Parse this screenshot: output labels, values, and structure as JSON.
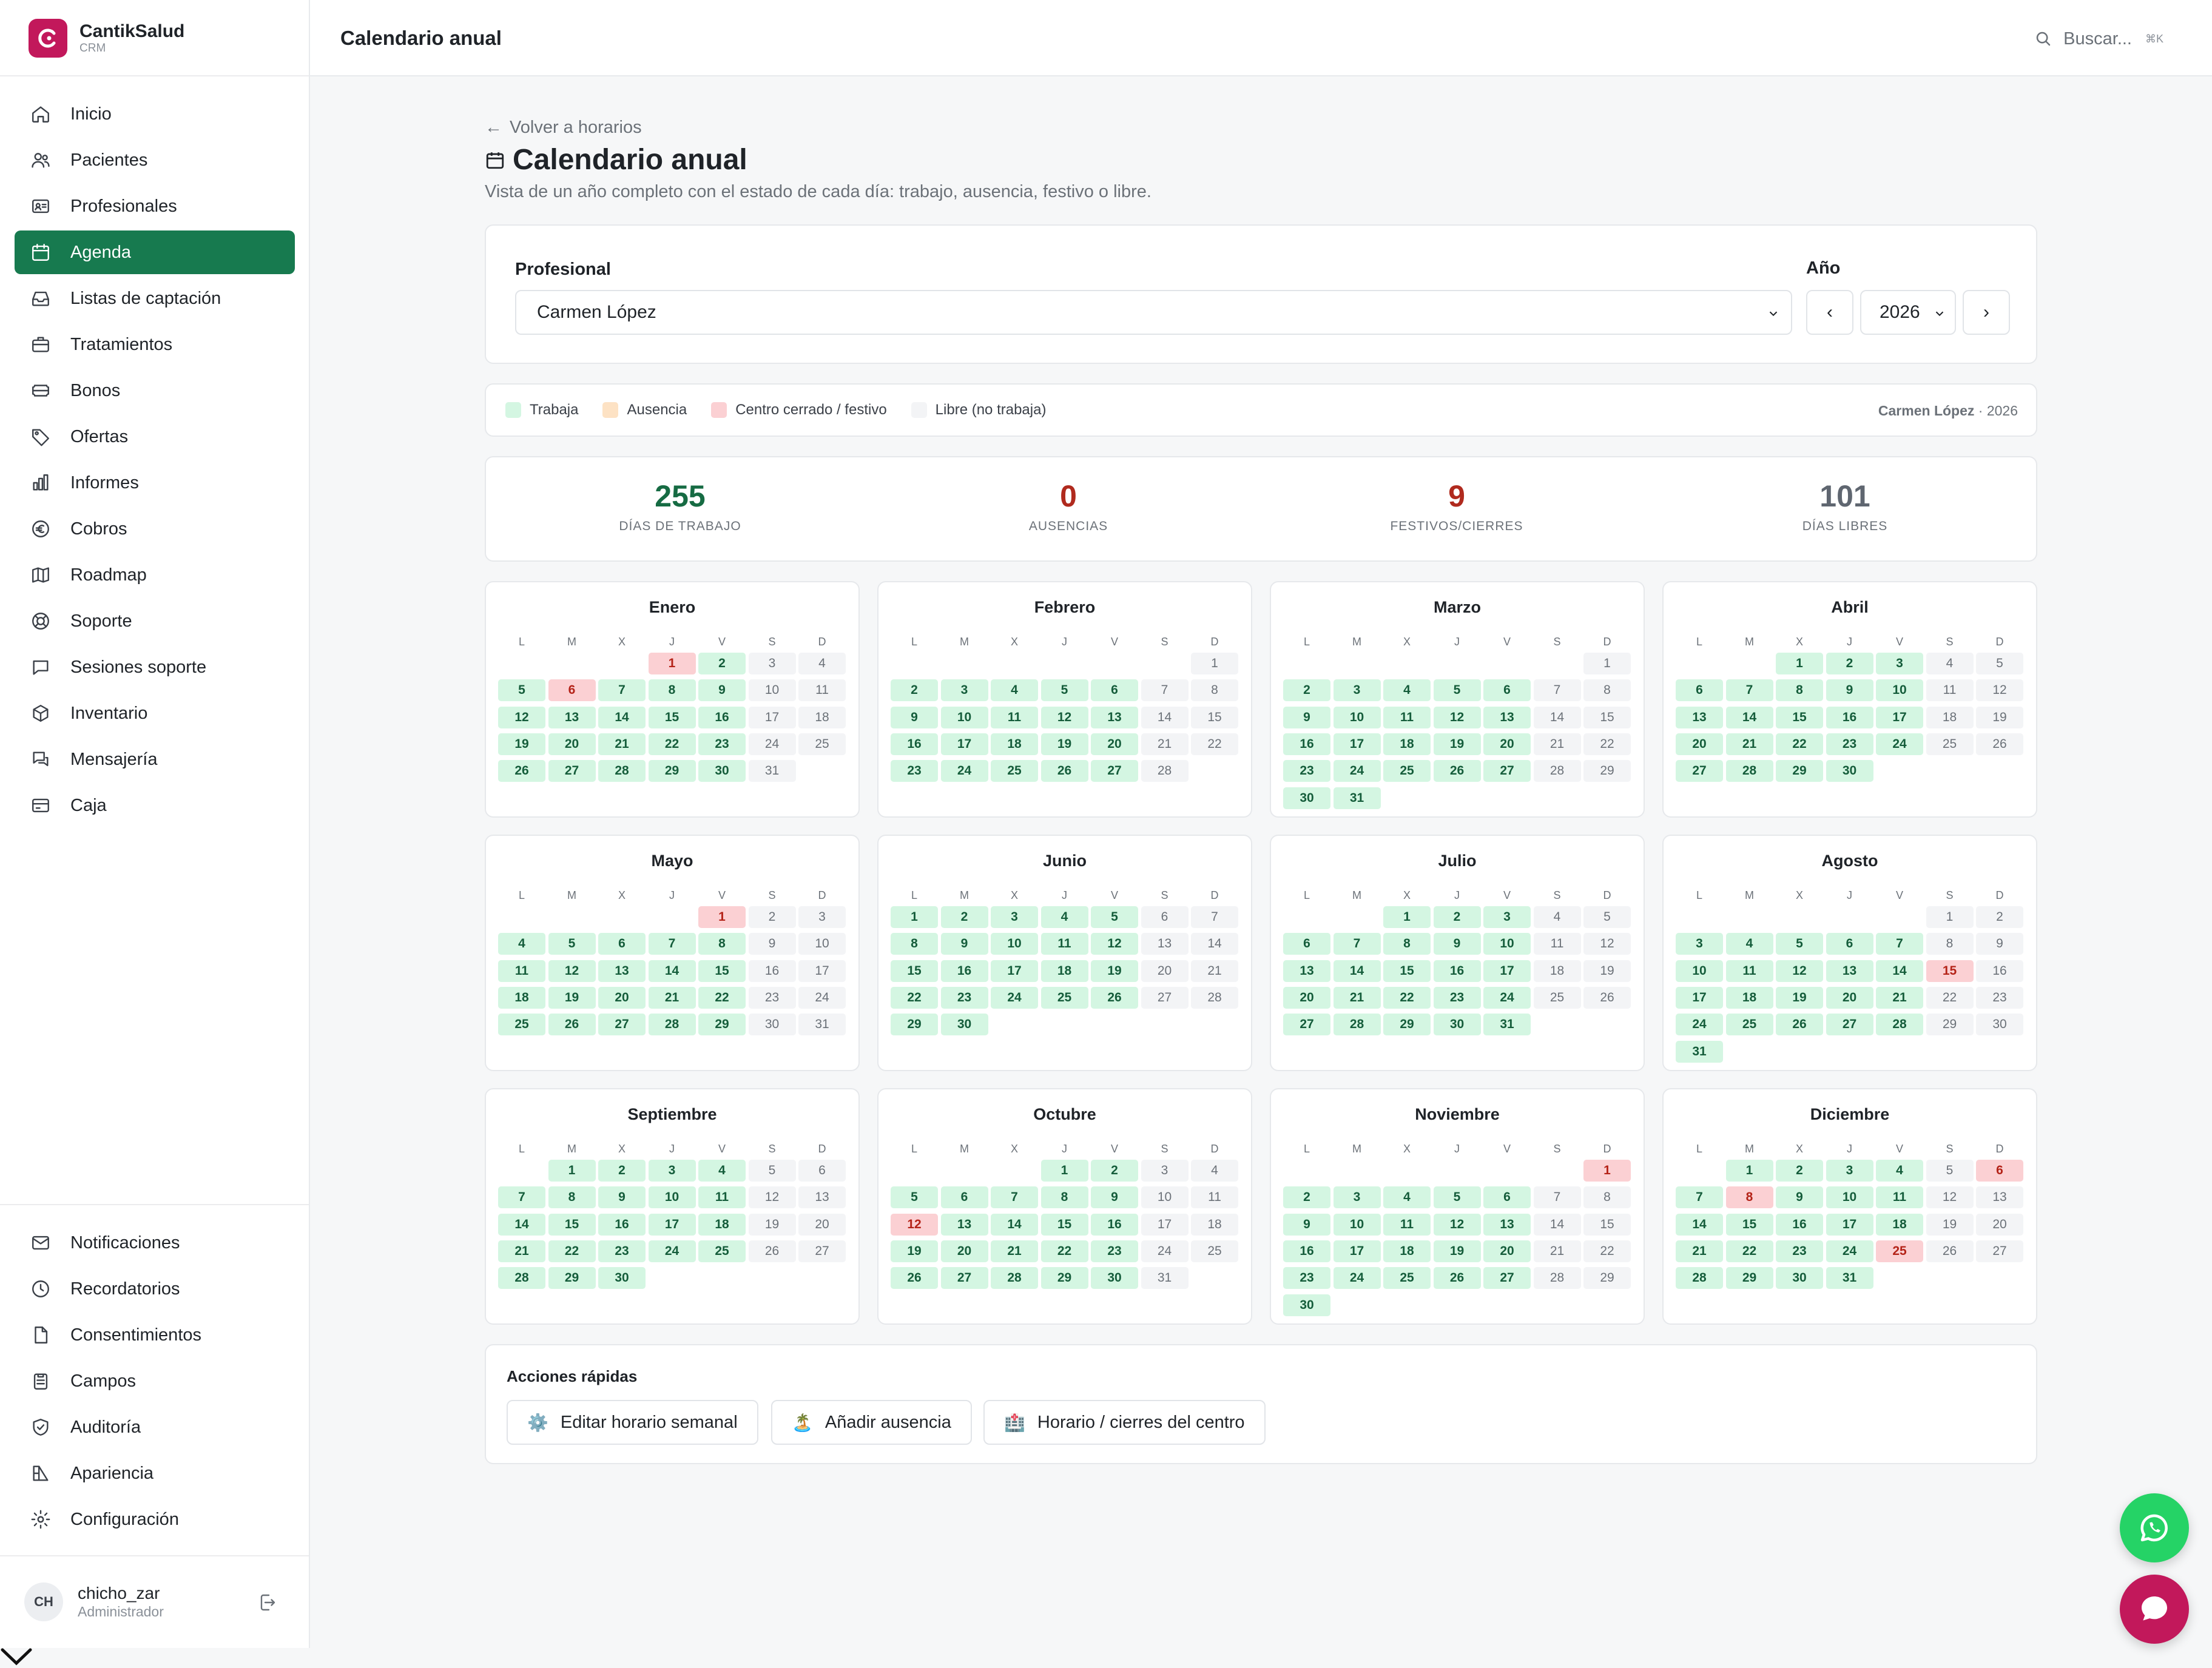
{
  "brand": {
    "name": "CantikSalud",
    "sub": "CRM"
  },
  "nav": [
    {
      "label": "Inicio",
      "icon": "home-icon"
    },
    {
      "label": "Pacientes",
      "icon": "users-icon"
    },
    {
      "label": "Profesionales",
      "icon": "id-card-icon"
    },
    {
      "label": "Agenda",
      "icon": "calendar-icon",
      "active": true
    },
    {
      "label": "Listas de captación",
      "icon": "inbox-icon"
    },
    {
      "label": "Tratamientos",
      "icon": "briefcase-icon"
    },
    {
      "label": "Bonos",
      "icon": "ticket-icon"
    },
    {
      "label": "Ofertas",
      "icon": "tag-icon"
    },
    {
      "label": "Informes",
      "icon": "bar-chart-icon"
    },
    {
      "label": "Cobros",
      "icon": "euro-icon"
    },
    {
      "label": "Roadmap",
      "icon": "map-icon"
    },
    {
      "label": "Soporte",
      "icon": "lifebuoy-icon"
    },
    {
      "label": "Sesiones soporte",
      "icon": "chat-icon"
    },
    {
      "label": "Inventario",
      "icon": "box-icon"
    },
    {
      "label": "Mensajería",
      "icon": "messages-icon"
    },
    {
      "label": "Caja",
      "icon": "credit-card-icon"
    }
  ],
  "nav_bottom": [
    {
      "label": "Notificaciones",
      "icon": "mail-icon"
    },
    {
      "label": "Recordatorios",
      "icon": "clock-icon"
    },
    {
      "label": "Consentimientos",
      "icon": "document-icon"
    },
    {
      "label": "Campos",
      "icon": "clipboard-icon"
    },
    {
      "label": "Auditoría",
      "icon": "shield-check-icon"
    },
    {
      "label": "Apariencia",
      "icon": "palette-icon"
    },
    {
      "label": "Configuración",
      "icon": "gear-icon"
    }
  ],
  "user": {
    "initials": "CH",
    "name": "chicho_zar",
    "role": "Administrador"
  },
  "header": {
    "title": "Calendario anual",
    "search_placeholder": "Buscar...",
    "search_shortcut": "⌘K"
  },
  "page": {
    "back_link": "Volver a horarios",
    "title": "Calendario anual",
    "description": "Vista de un año completo con el estado de cada día: trabajo, ausencia, festivo o libre."
  },
  "filters": {
    "professional_label": "Profesional",
    "professional_value": "Carmen López",
    "year_label": "Año",
    "year_value": "2026",
    "prev_label": "‹",
    "next_label": "›"
  },
  "legend": {
    "items": [
      {
        "label": "Trabaja",
        "color": "#d4f6e2"
      },
      {
        "label": "Ausencia",
        "color": "#fde2c4"
      },
      {
        "label": "Centro cerrado / festivo",
        "color": "#fbd0d3"
      },
      {
        "label": "Libre (no trabaja)",
        "color": "#f3f4f6"
      }
    ],
    "right_name": "Carmen López",
    "right_year": "· 2026"
  },
  "stats": [
    {
      "value": "255",
      "label": "DÍAS DE TRABAJO",
      "color": "#166b43"
    },
    {
      "value": "0",
      "label": "AUSENCIAS",
      "color": "#b02a1e"
    },
    {
      "value": "9",
      "label": "FESTIVOS/CIERRES",
      "color": "#b02a1e"
    },
    {
      "value": "101",
      "label": "DÍAS LIBRES",
      "color": "#5f6670"
    }
  ],
  "weekdays": [
    "L",
    "M",
    "X",
    "J",
    "V",
    "S",
    "D"
  ],
  "months": [
    {
      "name": "Enero",
      "start": 3,
      "days": 31,
      "holidays": [
        1,
        6
      ]
    },
    {
      "name": "Febrero",
      "start": 6,
      "days": 28,
      "holidays": []
    },
    {
      "name": "Marzo",
      "start": 6,
      "days": 31,
      "holidays": []
    },
    {
      "name": "Abril",
      "start": 2,
      "days": 30,
      "holidays": []
    },
    {
      "name": "Mayo",
      "start": 4,
      "days": 31,
      "holidays": [
        1
      ]
    },
    {
      "name": "Junio",
      "start": 0,
      "days": 30,
      "holidays": []
    },
    {
      "name": "Julio",
      "start": 2,
      "days": 31,
      "holidays": []
    },
    {
      "name": "Agosto",
      "start": 5,
      "days": 31,
      "holidays": [
        15
      ]
    },
    {
      "name": "Septiembre",
      "start": 1,
      "days": 30,
      "holidays": []
    },
    {
      "name": "Octubre",
      "start": 3,
      "days": 31,
      "holidays": [
        12
      ]
    },
    {
      "name": "Noviembre",
      "start": 6,
      "days": 30,
      "holidays": [
        1
      ]
    },
    {
      "name": "Diciembre",
      "start": 1,
      "days": 31,
      "holidays": [
        6,
        8,
        25
      ]
    }
  ],
  "actions": {
    "title": "Acciones rápidas",
    "buttons": [
      {
        "label": "Editar horario semanal",
        "icon": "⚙️"
      },
      {
        "label": "Añadir ausencia",
        "icon": "🏝️"
      },
      {
        "label": "Horario / cierres del centro",
        "icon": "🏥"
      }
    ]
  }
}
